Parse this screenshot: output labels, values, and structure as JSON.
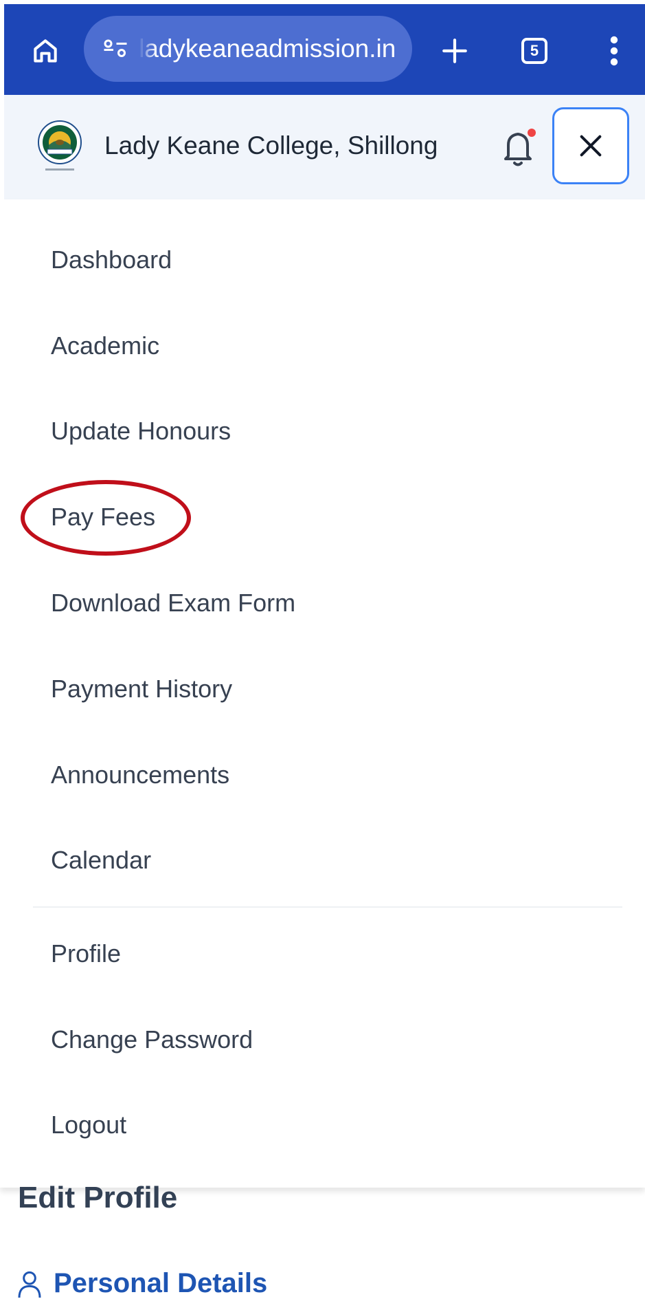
{
  "browser": {
    "url": "ladykeaneadmission.in",
    "tab_count": "5",
    "icons": [
      "home-icon",
      "site-info-icon",
      "plus-icon",
      "tab-switcher-icon",
      "more-vert-icon"
    ],
    "bar_color": "#1d46b7"
  },
  "header": {
    "title": "Lady Keane College, Shillong",
    "icons": [
      "college-logo",
      "bell-icon",
      "close-icon"
    ],
    "notification_dot_color": "#ef4444"
  },
  "menu": {
    "items": [
      {
        "label": "Dashboard"
      },
      {
        "label": "Academic"
      },
      {
        "label": "Update Honours"
      },
      {
        "label": "Pay Fees"
      },
      {
        "label": "Download Exam Form"
      },
      {
        "label": "Payment History"
      },
      {
        "label": "Announcements"
      },
      {
        "label": "Calendar"
      }
    ],
    "account_items": [
      {
        "label": "Profile"
      },
      {
        "label": "Change Password"
      },
      {
        "label": "Logout"
      }
    ],
    "highlight_color": "#c00f1a"
  },
  "page": {
    "heading": "Edit Profile",
    "section_label": "Personal Details",
    "section_icon": "user-icon"
  }
}
